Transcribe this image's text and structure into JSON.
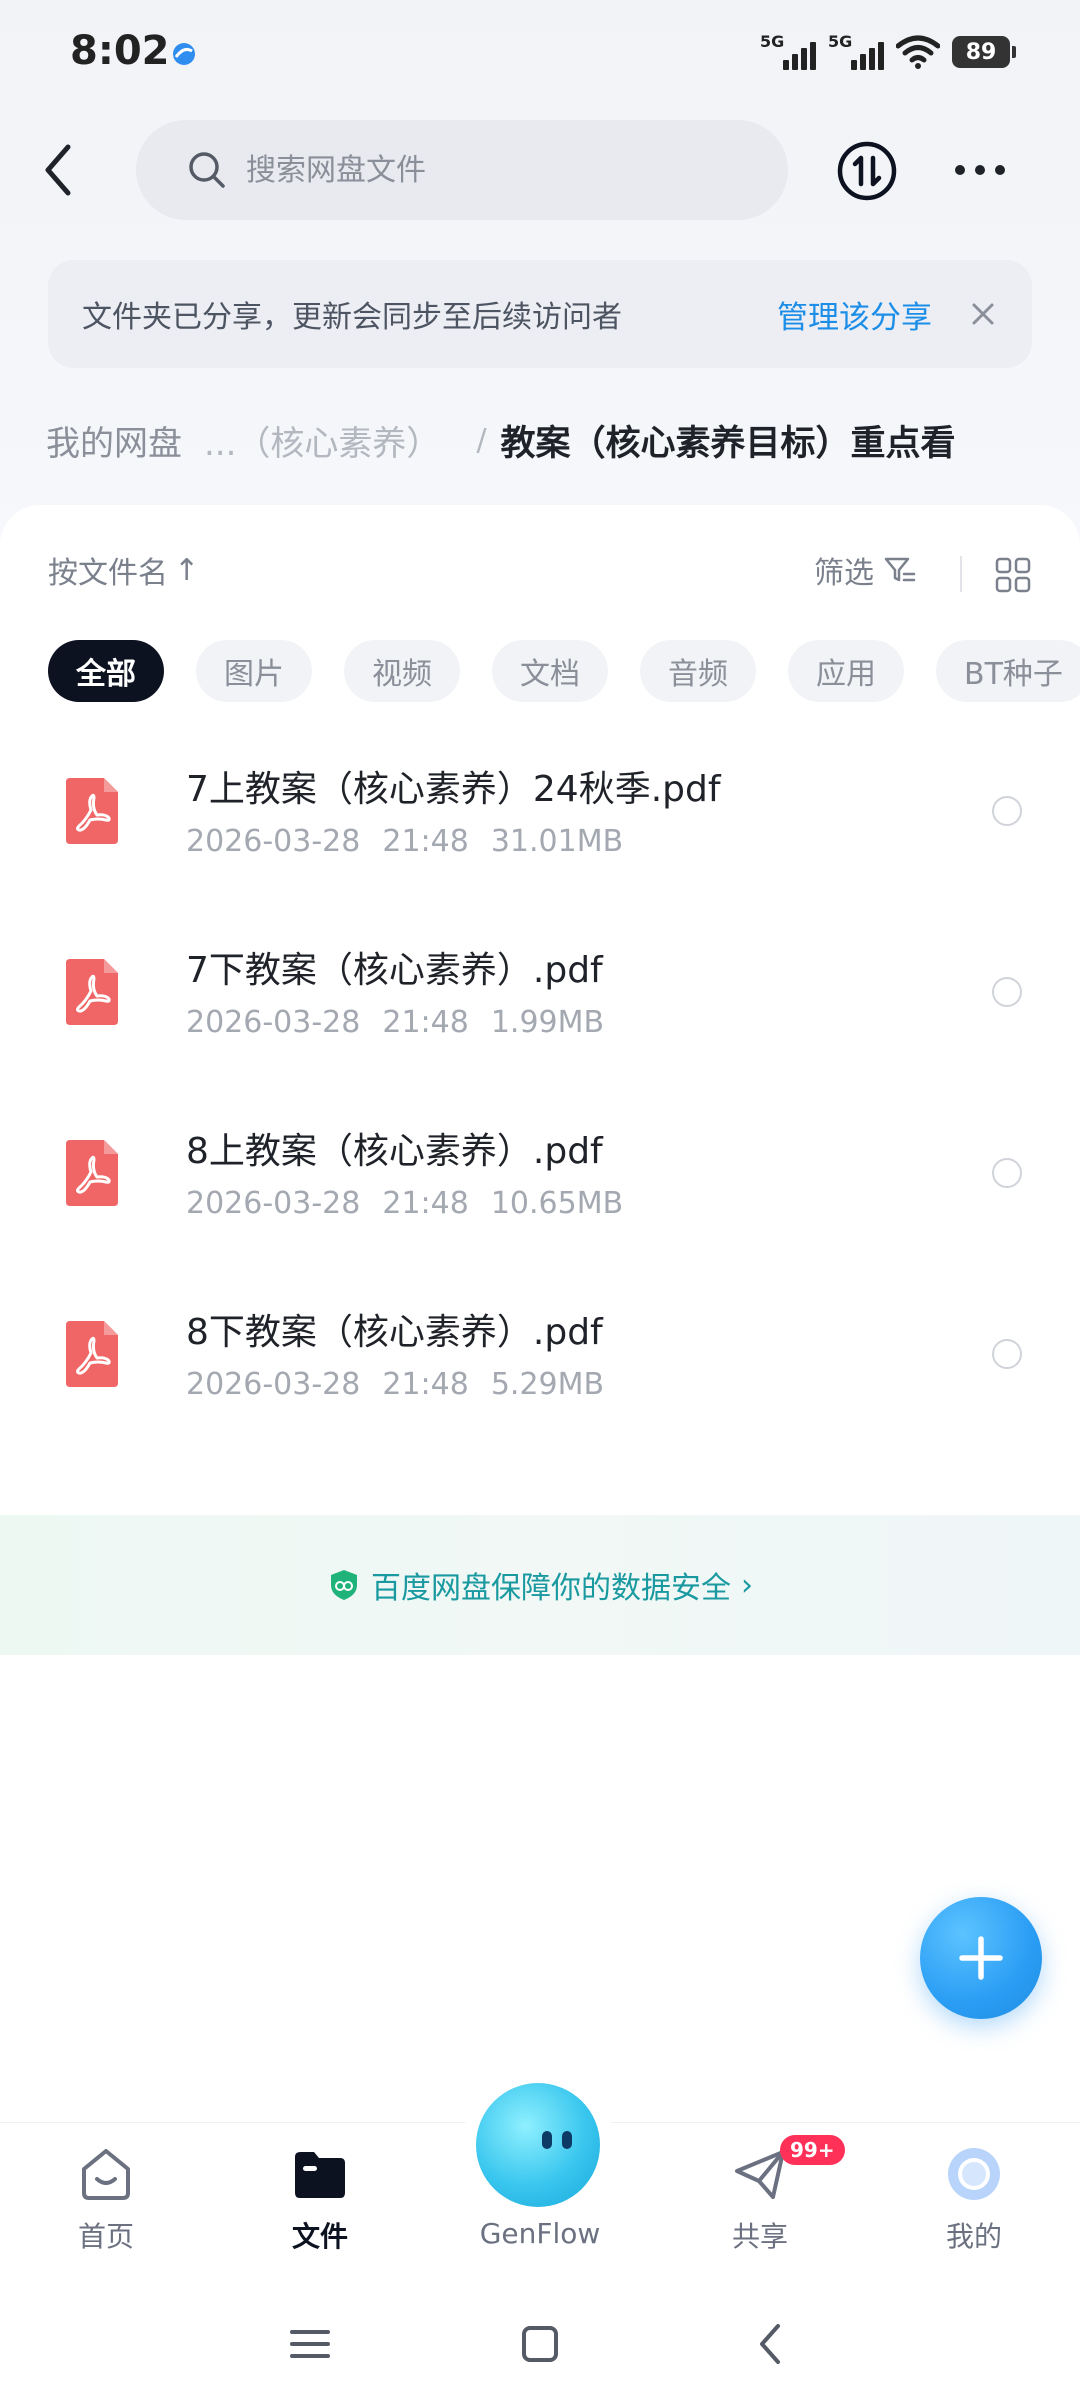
{
  "status_bar": {
    "time": "8:02",
    "network1": "5G",
    "network2": "5G",
    "battery": "89"
  },
  "header": {
    "search_placeholder": "搜索网盘文件",
    "back_icon": "chevron-left-icon",
    "transfer_icon": "transfer-icon",
    "more_icon": "more-icon"
  },
  "banner": {
    "text": "文件夹已分享，更新会同步至后续访问者",
    "link": "管理该分享",
    "link_color": "#1d8ee8"
  },
  "breadcrumb": {
    "root": "我的网盘",
    "middle": "...（核心素养）",
    "separator": "/",
    "current": "教案（核心素养目标）重点看"
  },
  "toolbar": {
    "sort_label": "按文件名",
    "sort_arrow": "↑",
    "filter_label": "筛选"
  },
  "chips": [
    "全部",
    "图片",
    "视频",
    "文档",
    "音频",
    "应用",
    "BT种子"
  ],
  "files": [
    {
      "name": "7上教案（核心素养）24秋季.pdf",
      "date": "2026-03-28",
      "time": "21:48",
      "size": "31.01MB"
    },
    {
      "name": "7下教案（核心素养）.pdf",
      "date": "2026-03-28",
      "time": "21:48",
      "size": "1.99MB"
    },
    {
      "name": "8上教案（核心素养）.pdf",
      "date": "2026-03-28",
      "time": "21:48",
      "size": "10.65MB"
    },
    {
      "name": "8下教案（核心素养）.pdf",
      "date": "2026-03-28",
      "time": "21:48",
      "size": "5.29MB"
    }
  ],
  "safety": {
    "text": "百度网盘保障你的数据安全",
    "arrow": "›"
  },
  "bottom_nav": {
    "home": "首页",
    "files": "文件",
    "genflow": "GenFlow",
    "share": "共享",
    "share_badge": "99+",
    "me": "我的"
  },
  "colors": {
    "accent": "#1d8ee8",
    "pdf_red": "#f06565",
    "active_chip": "#0c1220",
    "badge": "#ff3158"
  }
}
